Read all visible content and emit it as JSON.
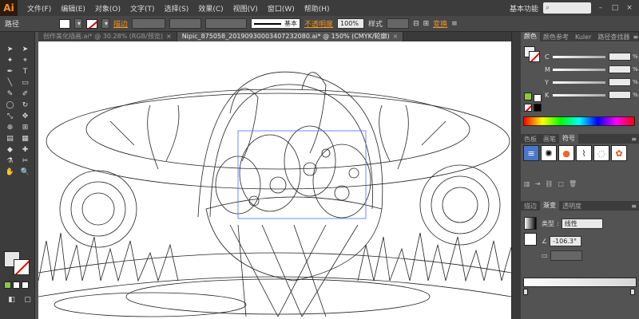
{
  "app": {
    "logo": "Ai",
    "menus": [
      "文件(F)",
      "编辑(E)",
      "对象(O)",
      "文字(T)",
      "选择(S)",
      "效果(C)",
      "视图(V)",
      "窗口(W)",
      "帮助(H)"
    ],
    "workspace": "基本功能",
    "window_buttons": [
      "–",
      "□",
      "×"
    ]
  },
  "control_bar": {
    "selection_type": "路径",
    "stroke_label": "描边",
    "stroke_style_label": "基本",
    "opacity_label": "不透明度",
    "opacity_value": "100%",
    "style_label": "样式",
    "transform_label": "变换"
  },
  "tabs": [
    {
      "label": "创作美化插画.ai* @ 30.28% (RGB/预览)",
      "active": false
    },
    {
      "label": "Nipic_875058_20190930003407232080.ai* @ 150% (CMYK/轮廓)",
      "active": true
    }
  ],
  "tools": [
    "➤",
    "➤",
    "✦",
    "⌖",
    "✒",
    "T",
    "╲",
    "▭",
    "✎",
    "✐",
    "◯",
    "↻",
    "⤡",
    "✥",
    "⊕",
    "⊞",
    "▤",
    "▦",
    "◆",
    "✚",
    "⚗",
    "✂",
    "✋",
    "🔍"
  ],
  "screen_mode": [
    "◧",
    "▢"
  ],
  "color_panel": {
    "tabs": [
      "颜色",
      "颜色参考",
      "Kuler",
      "路径查找器"
    ],
    "channels": [
      {
        "label": "C",
        "value": "",
        "unit": "%"
      },
      {
        "label": "M",
        "value": "",
        "unit": "%"
      },
      {
        "label": "Y",
        "value": "",
        "unit": "%"
      },
      {
        "label": "K",
        "value": "",
        "unit": "%"
      }
    ],
    "colors": {
      "accent_green": "#8dc63f",
      "none_slash": "#e00000"
    }
  },
  "symbols_panel": {
    "tabs": [
      "色板",
      "画笔",
      "符号"
    ],
    "items": [
      "≡",
      "✺",
      "●",
      "⌇",
      "◌",
      "✿"
    ]
  },
  "gradient_panel": {
    "tabs": [
      "描边",
      "渐变",
      "透明度"
    ],
    "type_label": "类型",
    "type_value": "线性",
    "angle_value": "-106.3°"
  }
}
